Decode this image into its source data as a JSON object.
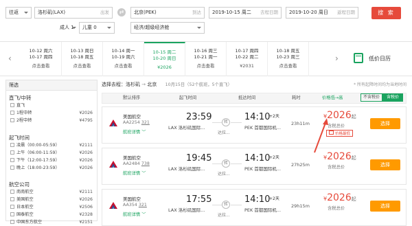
{
  "search": {
    "trip_type": "往返",
    "origin": "洛杉矶(LAX)",
    "origin_hint": "出发",
    "destination": "北京(PEK)",
    "destination_hint": "到达",
    "depart_date": "2019-10-15 周二",
    "depart_hint": "去程日期",
    "return_date": "2019-10-20 周日",
    "return_hint": "返程日期",
    "adults": "成人 1",
    "children": "儿童 0",
    "cabin": "经济/超级经济舱",
    "search_label": "搜 索"
  },
  "date_strip": {
    "prev_arrow": "‹",
    "next_arrow": "›",
    "dates": [
      {
        "go": "10-12 周六",
        "back": "10-17 周四",
        "price": "点击查看",
        "active": false
      },
      {
        "go": "10-13 周日",
        "back": "10-18 周五",
        "price": "点击查看",
        "active": false
      },
      {
        "go": "10-14 周一",
        "back": "10-19 周六",
        "price": "点击查看",
        "active": false
      },
      {
        "go": "10-15 周二",
        "back": "10-20 周日",
        "price": "¥2026",
        "active": true
      },
      {
        "go": "10-16 周三",
        "back": "10-21 周一",
        "price": "点击查看",
        "active": false
      },
      {
        "go": "10-17 周四",
        "back": "10-22 周二",
        "price": "¥2031",
        "active": false
      },
      {
        "go": "10-18 周五",
        "back": "10-23 周三",
        "price": "点击查看",
        "active": false
      }
    ],
    "calendar_label": "低价日历"
  },
  "sidebar": {
    "title": "筛选",
    "sections": {
      "stops": "直飞/中转",
      "takeoff": "起飞时间",
      "airline": "航空公司"
    },
    "stop_options": [
      {
        "label": "直飞",
        "price": ""
      },
      {
        "label": "1程中转",
        "price": "¥2026"
      },
      {
        "label": "2程中转",
        "price": "¥4795"
      }
    ],
    "time_options": [
      {
        "label": "凌晨（00:00-05:59）",
        "price": "¥2111"
      },
      {
        "label": "上午（06:00-11:59）",
        "price": "¥2026"
      },
      {
        "label": "下午（12:00-17:59）",
        "price": "¥2026"
      },
      {
        "label": "晚上（18:00-23:59）",
        "price": "¥2026"
      }
    ],
    "airline_options": [
      {
        "label": "南南航空",
        "price": "¥2111"
      },
      {
        "label": "美国航空",
        "price": "¥2026"
      },
      {
        "label": "日本航空",
        "price": "¥2506"
      },
      {
        "label": "国泰航空",
        "price": "¥2328"
      },
      {
        "label": "中国东方航空",
        "price": "¥2151"
      }
    ]
  },
  "results": {
    "route_label": "选择去程：洛杉矶",
    "route_to": "北京",
    "summary": "10月15日（52个航班，5个直飞）",
    "notice": "* 所有起降时间均为当地时间",
    "columns": {
      "sort": "默认排序",
      "depart": "起飞时间",
      "arrive": "抵达时间",
      "duration": "耗时",
      "price": "价格低→高",
      "no_tax": "不含税价",
      "with_tax": "含税价"
    },
    "flights": [
      {
        "airline": "美国航空",
        "flight_no": "AA2254",
        "plane": "321",
        "detail": "航班详情 ﹀",
        "depart_time": "23:59",
        "depart_airport": "LAX 洛杉矶国际...",
        "via": "转",
        "via_label": "达拉...",
        "arrive_time": "14:10",
        "plus_days": "+2天",
        "arrive_airport": "PEK 首都国际机...",
        "duration": "23h11m",
        "price": "2026",
        "price_suffix": "起",
        "tax": "含税总价",
        "tag": "价格最低",
        "select": "选择"
      },
      {
        "airline": "美国航空",
        "flight_no": "AA2484",
        "plane": "738",
        "detail": "航班详情 ﹀",
        "depart_time": "19:45",
        "depart_airport": "LAX 洛杉矶国际...",
        "via": "转",
        "via_label": "达拉...",
        "arrive_time": "14:10",
        "plus_days": "+2天",
        "arrive_airport": "PEK 首都国际机...",
        "duration": "27h25m",
        "price": "2026",
        "price_suffix": "起",
        "tax": "含税总价",
        "tag": "",
        "select": "选择"
      },
      {
        "airline": "美国航空",
        "flight_no": "AA354",
        "plane": "321",
        "detail": "航班详情 ﹀",
        "depart_time": "17:55",
        "depart_airport": "LAX 洛杉矶国际...",
        "via": "转",
        "via_label": "达拉...",
        "arrive_time": "14:10",
        "plus_days": "+2天",
        "arrive_airport": "PEK 首都国际机...",
        "duration": "29h15m",
        "price": "2026",
        "price_suffix": "起",
        "tax": "含税总价",
        "tag": "",
        "select": "选择"
      }
    ],
    "currency": "¥"
  },
  "colors": {
    "accent": "#1aa35f",
    "price": "#e64a3b",
    "select": "#ff9a00"
  }
}
